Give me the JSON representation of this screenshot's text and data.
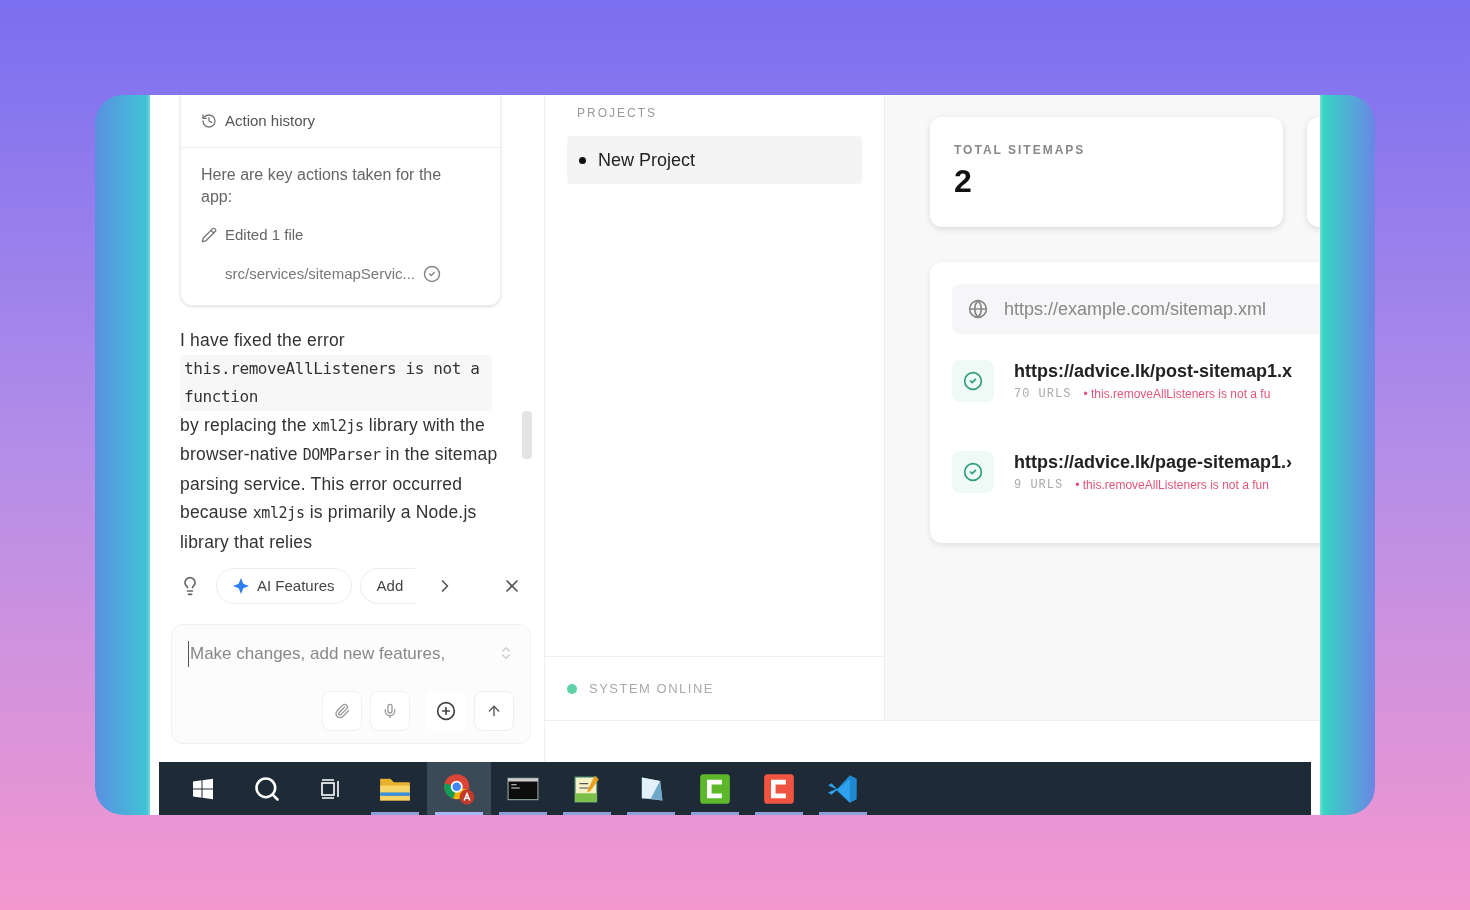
{
  "history_card": {
    "title": "Action history",
    "intro": "Here are key actions taken for the app:",
    "edit_label": "Edited 1 file",
    "file_path": "src/services/sitemapServic...",
    "file_done": true
  },
  "message": [
    {
      "kind": "text",
      "text": "I have fixed the error"
    },
    {
      "kind": "block_code",
      "text": "this.removeAllListeners is not a function"
    },
    {
      "kind": "text",
      "text": "by replacing the "
    },
    {
      "kind": "code",
      "text": "xml2js"
    },
    {
      "kind": "text",
      "text": " library with the browser-native "
    },
    {
      "kind": "code",
      "text": "DOMParser"
    },
    {
      "kind": "text",
      "text": " in the sitemap parsing service. This error occurred because "
    },
    {
      "kind": "code",
      "text": "xml2js"
    },
    {
      "kind": "text",
      "text": " is primarily a Node.js library that relies"
    }
  ],
  "suggestions": [
    {
      "label": "AI Features",
      "kind": "ai"
    },
    {
      "label": "Add",
      "kind": "plain"
    }
  ],
  "composer": {
    "placeholder": "Make changes, add new features,"
  },
  "projects": {
    "heading": "PROJECTS",
    "items": [
      {
        "label": "New Project",
        "selected": true
      }
    ]
  },
  "status": {
    "label": "SYSTEM ONLINE",
    "color": "#5fd3a8"
  },
  "stats": [
    {
      "label": "TOTAL SITEMAPS",
      "value": "2"
    }
  ],
  "url_field": {
    "placeholder": "https://example.com/sitemap.xml"
  },
  "sitemaps": [
    {
      "url": "https://advice.lk/post-sitemap1.x",
      "count": "70 URLS",
      "error": "• this.removeAllListeners is not a fu",
      "ok": true
    },
    {
      "url": "https://advice.lk/page-sitemap1.›",
      "count": "9 URLS",
      "error": "• this.removeAllListeners is not a fun",
      "ok": true
    }
  ],
  "taskbar": {
    "items": [
      {
        "selected": false,
        "running": false
      },
      {
        "selected": false,
        "running": false
      },
      {
        "selected": false,
        "running": false
      },
      {
        "selected": false,
        "running": true
      },
      {
        "selected": true,
        "running": true
      },
      {
        "selected": false,
        "running": true
      },
      {
        "selected": false,
        "running": true
      },
      {
        "selected": false,
        "running": true
      },
      {
        "selected": false,
        "running": true
      },
      {
        "selected": false,
        "running": true
      },
      {
        "selected": false,
        "running": true
      }
    ]
  }
}
